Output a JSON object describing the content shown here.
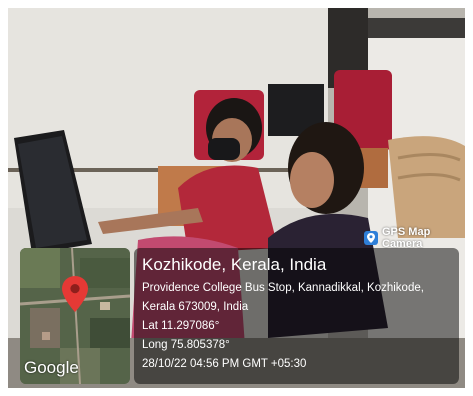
{
  "badge": {
    "icon": "map-pin-icon",
    "label": "GPS Map Camera"
  },
  "location": {
    "place": "Kozhikode, Kerala, India",
    "address_line1": "Providence College Bus Stop, Kannadikkal, Kozhikode,",
    "address_line2": "Kerala 673009, India",
    "latitude": "Lat 11.297086°",
    "longitude": "Long 75.805378°",
    "timestamp": "28/10/22 04:56 PM GMT +05:30"
  },
  "map": {
    "provider_label": "Google",
    "marker_icon": "map-marker-icon",
    "marker_color": "#e53935"
  },
  "colors": {
    "overlay_bg": "#000000",
    "badge_accent": "#2f7fd8"
  }
}
